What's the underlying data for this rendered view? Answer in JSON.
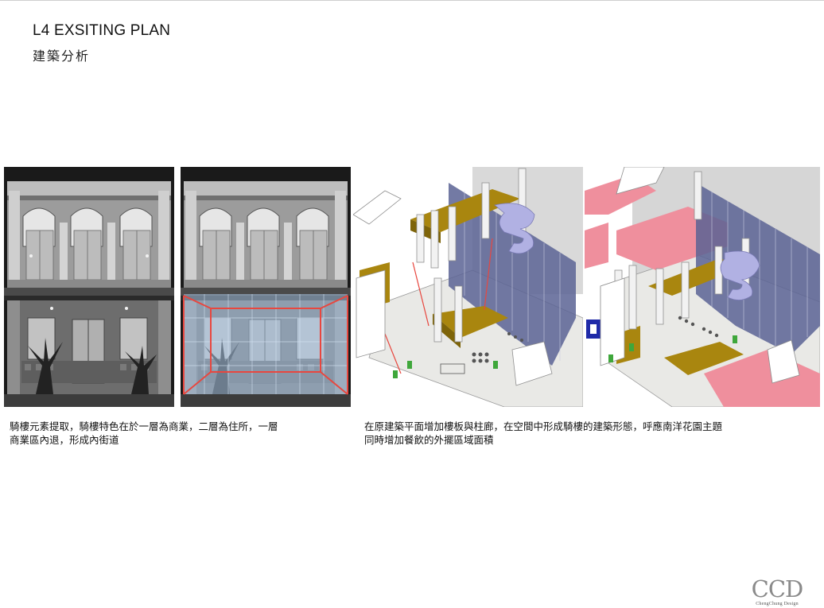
{
  "header": {
    "title": "L4 EXSITING PLAN",
    "subtitle": "建築分析"
  },
  "captions": {
    "left": {
      "line1": "騎樓元素提取，騎樓特色在於一層為商業，二層為住所，一層",
      "line2": "商業區內退，形成內街道"
    },
    "right": {
      "line1": "在原建築平面增加樓板與柱廊，在空間中形成騎樓的建築形態，呼應南洋花園主題",
      "line2": "同時增加餐飲的外擺區域面積"
    }
  },
  "logo": {
    "mark": "CCD",
    "sub": "ChengChung Design"
  },
  "colors": {
    "highlight_red": "#e8473f",
    "slab_gold": "#a9860f",
    "glass_blue": "#5a6394",
    "pink_zone": "#ef8f9d",
    "stair_lilac": "#b1b1e3"
  }
}
